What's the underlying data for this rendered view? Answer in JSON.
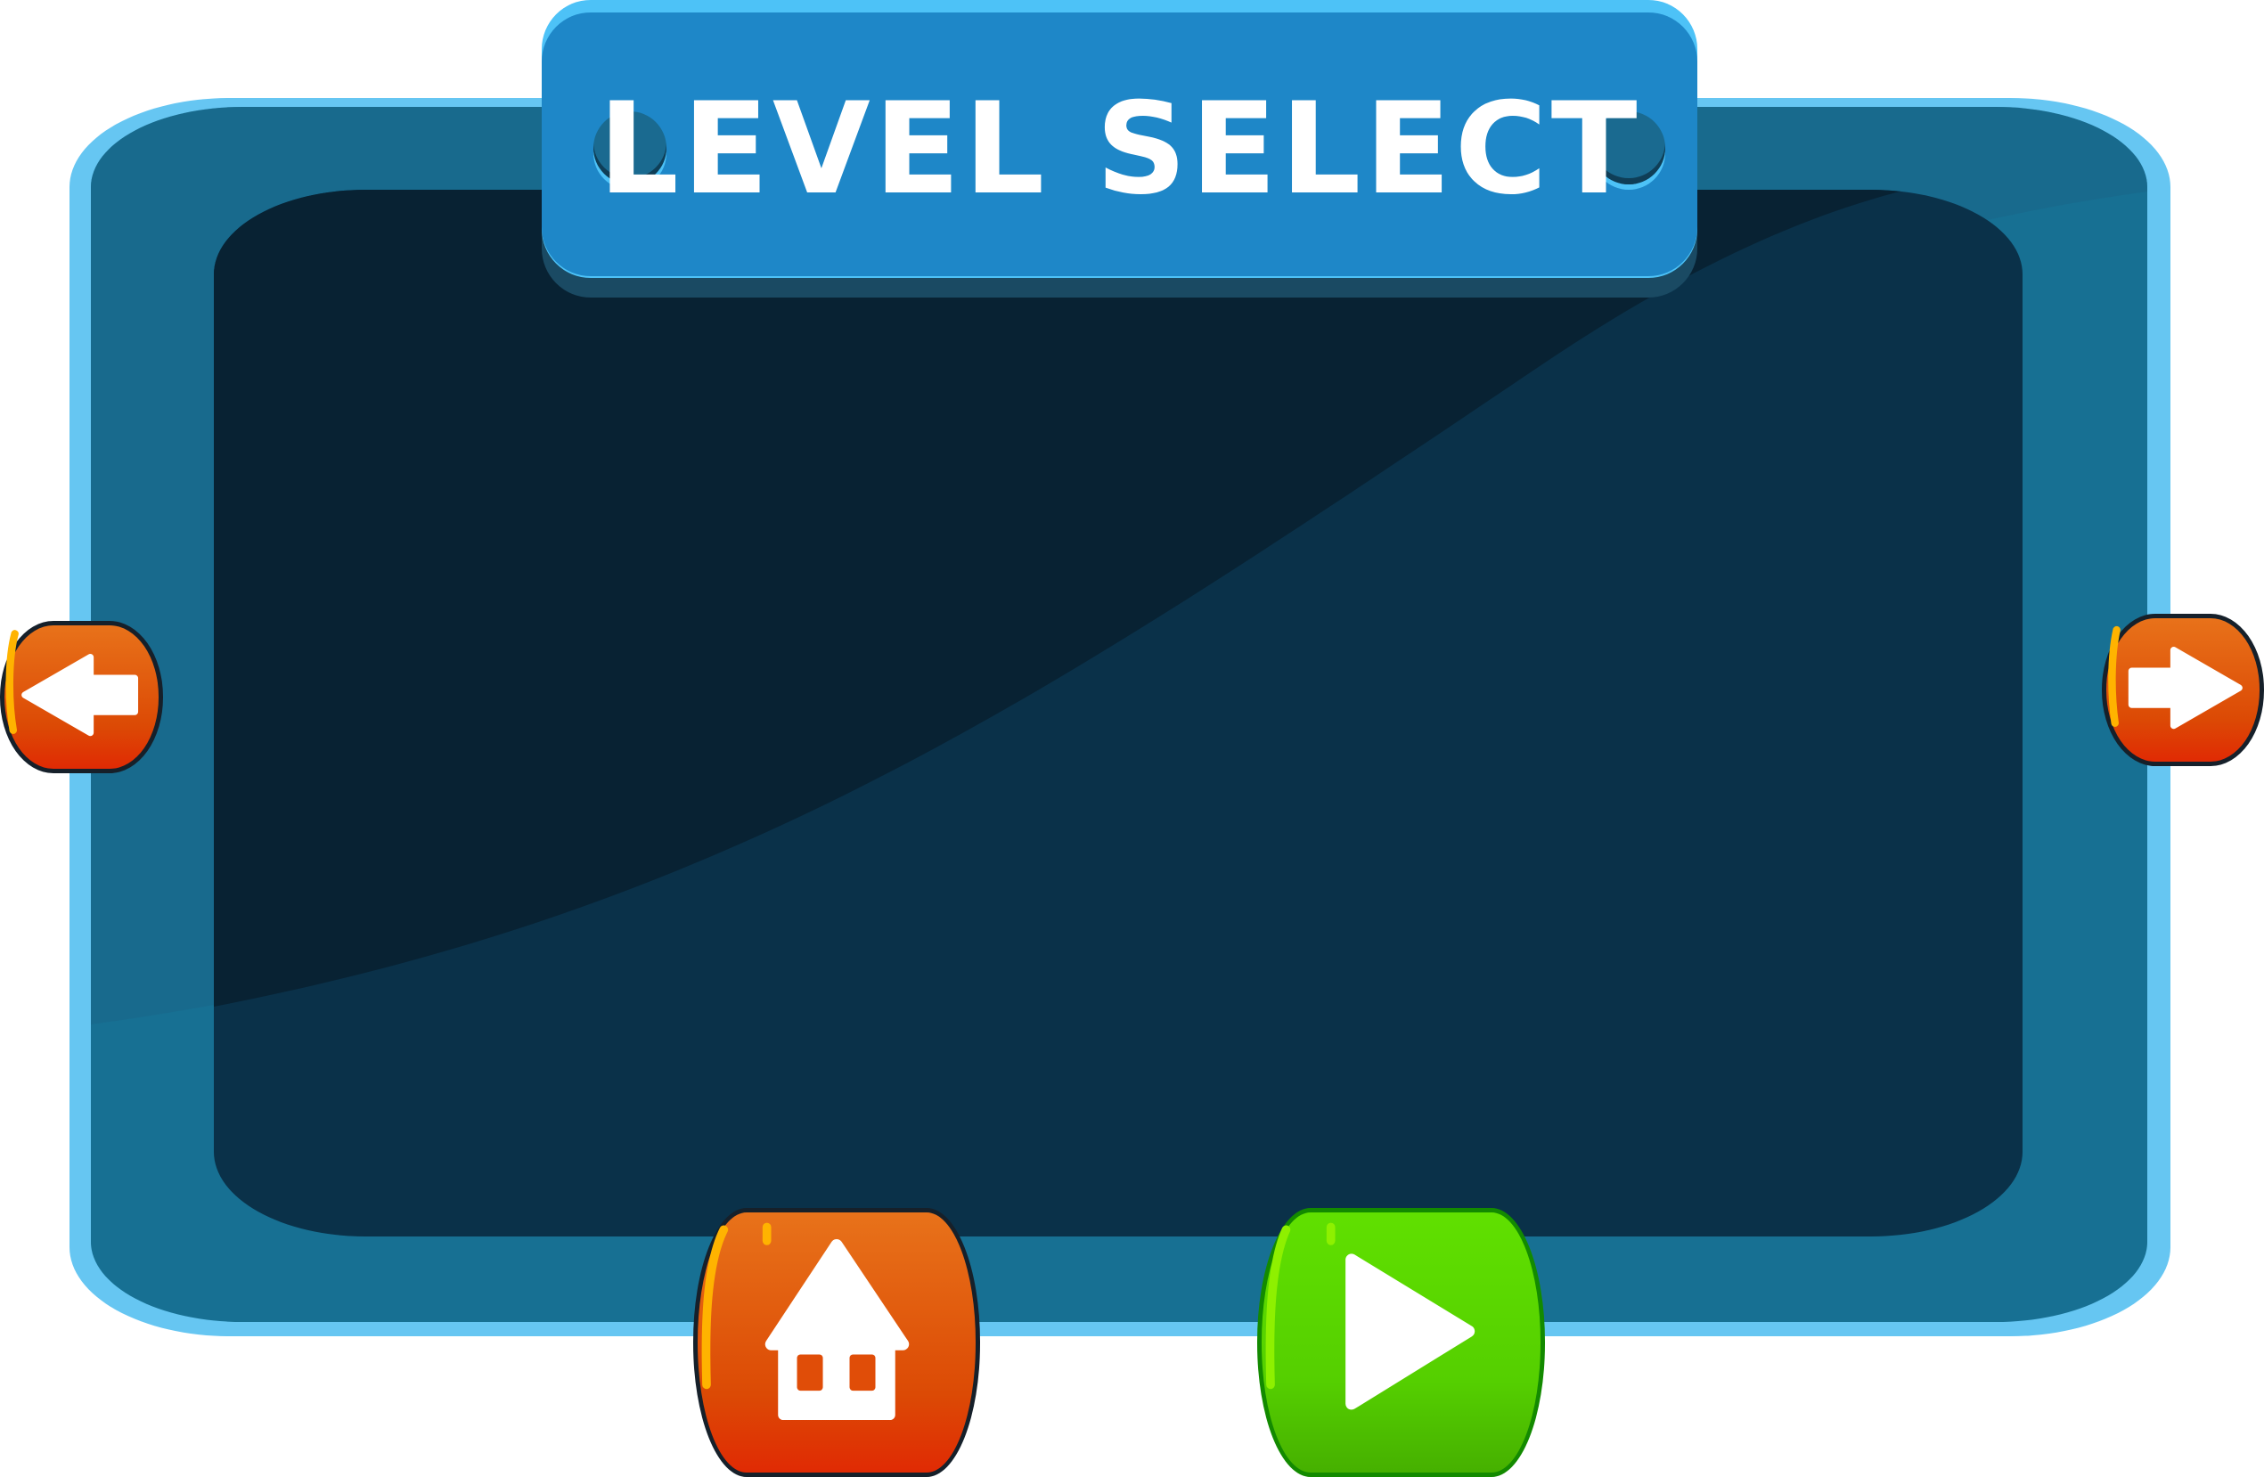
{
  "header": {
    "title": "LEVEL SELECT"
  },
  "buttons": {
    "prev": {
      "icon": "arrow-left-icon"
    },
    "next": {
      "icon": "arrow-right-icon"
    },
    "home": {
      "icon": "home-icon"
    },
    "play": {
      "icon": "play-icon"
    }
  },
  "colors": {
    "frame_outer": "#66c6f2",
    "frame": "#177093",
    "screen": "#0a3149",
    "banner": "#1e87c8",
    "button_orange": "#dc4a05",
    "button_green": "#55cf00",
    "icon": "#ffffff"
  }
}
